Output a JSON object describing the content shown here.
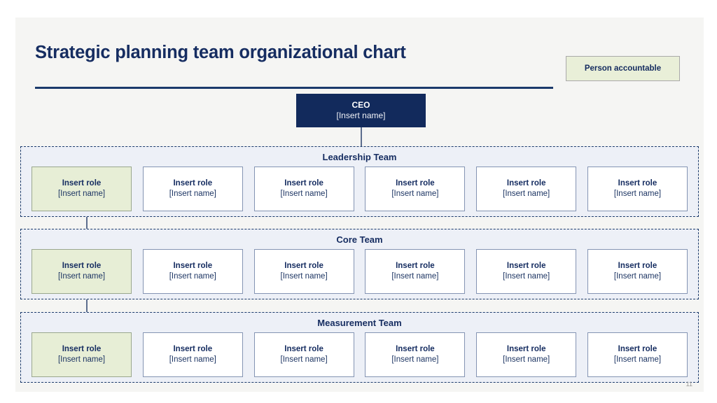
{
  "page": {
    "title": "Strategic planning team organizational chart",
    "page_number": "11",
    "background_color": "#f5f5f3",
    "accent_color": "#162d61"
  },
  "legend": {
    "label": "Person accountable",
    "fill_color": "#e9efd8",
    "border_color": "#a9a9a9"
  },
  "ceo": {
    "role": "CEO",
    "person": "[Insert name]",
    "fill_color": "#122a5c",
    "text_color": "#ffffff"
  },
  "colors": {
    "section_fill": "#edf0f7",
    "section_border": "#1b3a6b",
    "card_fill": "#ffffff",
    "card_border": "#8494b3",
    "accountable_fill": "#e7eed6",
    "accountable_border": "#9aa78e",
    "connector": "#5c6d8e"
  },
  "sections": [
    {
      "title": "Leadership Team",
      "cards": [
        {
          "role": "Insert role",
          "person": "[Insert name]",
          "accountable": true
        },
        {
          "role": "Insert role",
          "person": "[Insert name]",
          "accountable": false
        },
        {
          "role": "Insert role",
          "person": "[Insert name]",
          "accountable": false
        },
        {
          "role": "Insert role",
          "person": "[Insert name]",
          "accountable": false
        },
        {
          "role": "Insert role",
          "person": "[Insert name]",
          "accountable": false
        },
        {
          "role": "Insert role",
          "person": "[Insert name]",
          "accountable": false
        }
      ]
    },
    {
      "title": "Core Team",
      "cards": [
        {
          "role": "Insert role",
          "person": "[Insert name]",
          "accountable": true
        },
        {
          "role": "Insert role",
          "person": "[Insert name]",
          "accountable": false
        },
        {
          "role": "Insert role",
          "person": "[Insert name]",
          "accountable": false
        },
        {
          "role": "Insert role",
          "person": "[Insert name]",
          "accountable": false
        },
        {
          "role": "Insert role",
          "person": "[Insert name]",
          "accountable": false
        },
        {
          "role": "Insert role",
          "person": "[Insert name]",
          "accountable": false
        }
      ]
    },
    {
      "title": "Measurement Team",
      "cards": [
        {
          "role": "Insert role",
          "person": "[Insert name]",
          "accountable": true
        },
        {
          "role": "Insert role",
          "person": "[Insert name]",
          "accountable": false
        },
        {
          "role": "Insert role",
          "person": "[Insert name]",
          "accountable": false
        },
        {
          "role": "Insert role",
          "person": "[Insert name]",
          "accountable": false
        },
        {
          "role": "Insert role",
          "person": "[Insert name]",
          "accountable": false
        },
        {
          "role": "Insert role",
          "person": "[Insert name]",
          "accountable": false
        }
      ]
    }
  ]
}
